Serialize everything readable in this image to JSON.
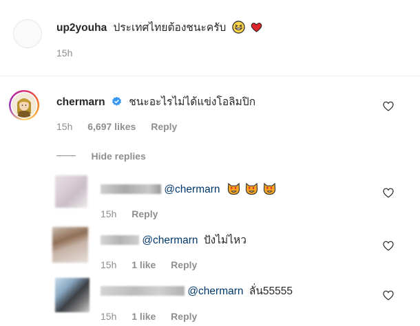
{
  "comment_top": {
    "username": "up2youha",
    "text": "ประเทศไทยต้องชนะครับ",
    "emojis": [
      "grinning-squint-emoji",
      "red-heart-emoji"
    ],
    "time": "15h"
  },
  "comment_main": {
    "username": "chermarn",
    "verified": true,
    "text": "ชนะอะไรไม่ได้แข่งโอลิมปิก",
    "time": "15h",
    "likes": "6,697 likes",
    "reply": "Reply",
    "hide_replies": "Hide replies"
  },
  "replies": [
    {
      "mention": "@chermarn",
      "text": "",
      "emojis": [
        "heart-eyes-cat-emoji",
        "heart-eyes-cat-emoji",
        "heart-eyes-cat-emoji"
      ],
      "time": "15h",
      "likes": "",
      "reply": "Reply"
    },
    {
      "mention": "@chermarn",
      "text": "ปังไม่ไหว",
      "time": "15h",
      "likes": "1 like",
      "reply": "Reply"
    },
    {
      "mention": "@chermarn",
      "text": "ลั่น55555",
      "time": "15h",
      "likes": "1 like",
      "reply": "Reply"
    }
  ],
  "colors": {
    "text": "#262626",
    "muted": "#8e8e8e",
    "mention": "#00376b",
    "verified": "#3897f0",
    "divider": "#efefef"
  }
}
